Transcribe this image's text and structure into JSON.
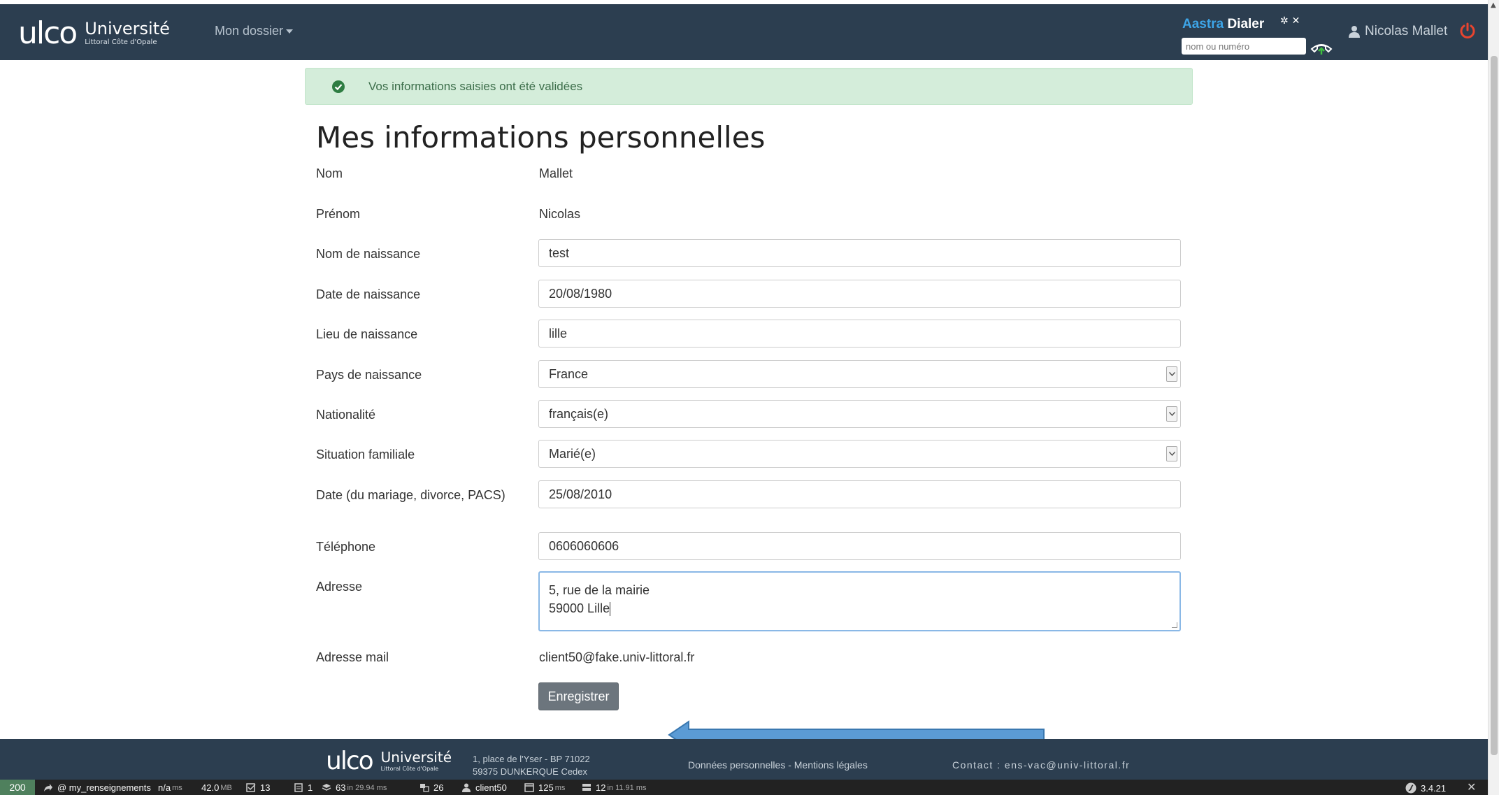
{
  "app": {
    "logo_mark": "ulco",
    "logo_name": "Université",
    "logo_sub": "Littoral Côte d'Opale",
    "menu_label": "Mon dossier"
  },
  "dialer": {
    "brand_a": "Aastra",
    "brand_b": "Dialer",
    "controls": "✲ ✕",
    "placeholder": "nom ou numéro"
  },
  "user": {
    "name": "Nicolas Mallet"
  },
  "alert": {
    "text": "Vos informations saisies ont été validées"
  },
  "page": {
    "title": "Mes informations personnelles"
  },
  "form": {
    "nom": {
      "label": "Nom",
      "value": "Mallet"
    },
    "prenom": {
      "label": "Prénom",
      "value": "Nicolas"
    },
    "nom_naissance": {
      "label": "Nom de naissance",
      "value": "test"
    },
    "date_naissance": {
      "label": "Date de naissance",
      "value": "20/08/1980"
    },
    "lieu_naissance": {
      "label": "Lieu de naissance",
      "value": "lille"
    },
    "pays_naissance": {
      "label": "Pays de naissance",
      "value": "France"
    },
    "nationalite": {
      "label": "Nationalité",
      "value": "français(e)"
    },
    "situation": {
      "label": "Situation familiale",
      "value": "Marié(e)"
    },
    "date_mariage": {
      "label": "Date (du mariage, divorce, PACS)",
      "value": "25/08/2010"
    },
    "telephone": {
      "label": "Téléphone",
      "value": "0606060606"
    },
    "adresse": {
      "label": "Adresse",
      "line1": "5, rue de la mairie",
      "line2": "59000 Lille"
    },
    "mail": {
      "label": "Adresse mail",
      "value": "client50@fake.univ-littoral.fr"
    },
    "submit_label": "Enregistrer"
  },
  "footer": {
    "address_line1": "1, place de l'Yser - BP 71022",
    "address_line2": "59375 DUNKERQUE Cedex",
    "links": "Données personnelles - Mentions légales",
    "contact": "Contact : ens-vac@univ-littoral.fr"
  },
  "debugbar": {
    "status": "200",
    "route": "@ my_renseignements",
    "time": "n/a",
    "time_unit": "ms",
    "memory": "42.0",
    "memory_unit": "MB",
    "forms": "13",
    "logs": "1",
    "cache": "63",
    "cache_unit": "in 29.94 ms",
    "translations": "26",
    "user": "client50",
    "twig": "125",
    "twig_unit": "ms",
    "db": "12",
    "db_unit": "in 11.91 ms",
    "version": "3.4.21"
  },
  "colors": {
    "navbar": "#2c3e50",
    "alert_bg": "#d4edda",
    "alert_icon": "#2e7d42",
    "button": "#6c757d",
    "status_ok": "#4f805d",
    "annotation_arrow": "#5b9bd5",
    "power_icon": "#e8442f"
  }
}
